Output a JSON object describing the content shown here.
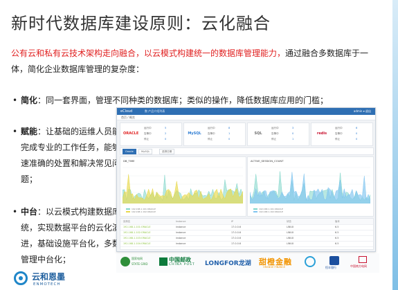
{
  "title": "新时代数据库建设原则：云化融合",
  "intro": {
    "red": "公有云和私有云技术架构走向融合，以云模式构建统一的数据库管理能力，",
    "rest": "通过融合多数据库于一体，简化企业数据库管理的复杂度："
  },
  "bullets": [
    {
      "dot": "•",
      "head": "简化",
      "body": "：同一套界面，管理不同种类的数据库；类似的操作，降低数据库应用的门槛；"
    },
    {
      "dot": "•",
      "head": "赋能",
      "body": "：让基础的运维人员能够完成专业的工作任务，能够快速准确的处置和解决常见问题；"
    },
    {
      "dot": "•",
      "head": "中台",
      "body": "：以云模式构建数据库系统，实现数据平台的云化演进，基础设施平台化，多数据管理中台化；"
    }
  ],
  "dashboard": {
    "brand": "eCloud",
    "crumb": "数 产品介绍列表",
    "user": "admin ▾ 退出",
    "sub": "首页 / 概览",
    "cards": [
      {
        "logo": "ORACLE",
        "color": "#e02020",
        "stats": [
          [
            "运行中",
            "5"
          ],
          [
            "告警中",
            "2"
          ],
          [
            "停止",
            "0"
          ]
        ]
      },
      {
        "logo": "MySQL",
        "color": "#2a7ad2",
        "stats": [
          [
            "运行中",
            "8"
          ],
          [
            "告警中",
            "1"
          ],
          [
            "停止",
            "0"
          ]
        ]
      },
      {
        "logo": "SQL",
        "color": "#6b6b6b",
        "stats": [
          [
            "运行中",
            "3"
          ],
          [
            "告警中",
            "0"
          ],
          [
            "停止",
            "1"
          ]
        ]
      },
      {
        "logo": "redis",
        "color": "#c8102e",
        "stats": [
          [
            "运行中",
            "6"
          ],
          [
            "告警中",
            "0"
          ],
          [
            "停止",
            "0"
          ]
        ]
      }
    ],
    "tabs": [
      "Oracle",
      "MySQL",
      "选择日期"
    ],
    "panels": [
      "DB_TIME",
      "ACTIVE_SESSION_COUNT"
    ],
    "legend": [
      "192.168.1.101:ORACLE",
      "192.168.1.102:ORACLE"
    ],
    "table_rows": [
      [
        "实例名",
        "Instance",
        "IP",
        "状态",
        "版本"
      ],
      [
        "192.168.1.101:ORACLE",
        "instance",
        "17.0.0.6",
        "LINUX",
        "6.5"
      ],
      [
        "192.168.1.102:ORACLE",
        "instance",
        "17.0.0.6",
        "LINUX",
        "6.5"
      ],
      [
        "192.168.1.103:ORACLE",
        "instance",
        "17.0.0.6",
        "LINUX",
        "6.5"
      ],
      [
        "192.168.1.104:ORACLE",
        "instance",
        "17.0.0.6",
        "LINUX",
        "6.5"
      ]
    ],
    "series_colors": [
      "#7fd6c9",
      "#e8d94a",
      "#7fc4ef"
    ]
  },
  "logos": {
    "lg1_a": "国家电网",
    "lg1_b": "STATE GRID",
    "lg2_a": "中国邮政",
    "lg2_b": "CHINA POST",
    "lg3_a": "LONGFOR",
    "lg3_b": "龙湖",
    "lg4_a": "甜橙金融",
    "lg4_b": "ORANGE FINANCE",
    "lg6_a": "恒丰银行",
    "lg7_a": "中国南方电网"
  },
  "corp": {
    "cn": "云和恩墨",
    "en": "ENMOTECH"
  }
}
